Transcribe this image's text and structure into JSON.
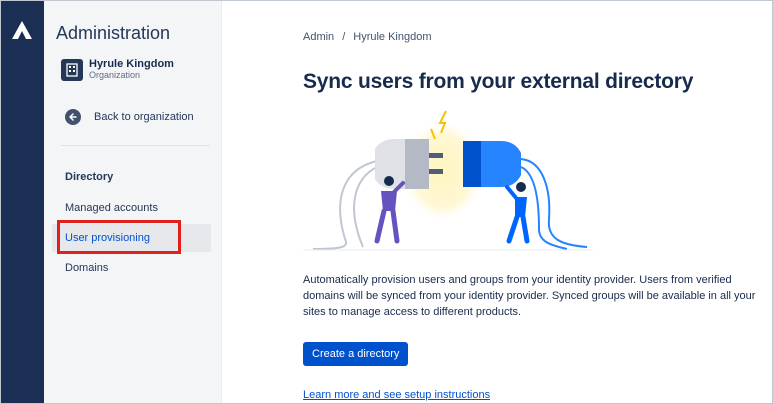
{
  "app": {
    "logo_icon": "atlassian-logo-icon"
  },
  "sidebar": {
    "title": "Administration",
    "org": {
      "name": "Hyrule Kingdom",
      "type": "Organization",
      "icon": "building-icon"
    },
    "back_label": "Back to organization",
    "section_heading": "Directory",
    "items": [
      {
        "label": "Managed accounts",
        "active": false
      },
      {
        "label": "User provisioning",
        "active": true,
        "highlighted": true
      },
      {
        "label": "Domains",
        "active": false
      }
    ]
  },
  "breadcrumb": {
    "items": [
      "Admin",
      "Hyrule Kingdom"
    ],
    "separator": "/"
  },
  "main": {
    "title": "Sync users from your external directory",
    "illustration": "plug-connection-illustration",
    "description": "Automatically provision users and groups from your identity provider. Users from verified domains will be synced from your identity provider. Synced groups will be available in all your sites to manage access to different products.",
    "cta_label": "Create a directory",
    "learn_more": "Learn more and see setup instructions"
  },
  "colors": {
    "rail": "#1b2f54",
    "primary": "#0052cc",
    "highlight": "#e0201b",
    "sidebar_bg": "#f4f5f7"
  }
}
